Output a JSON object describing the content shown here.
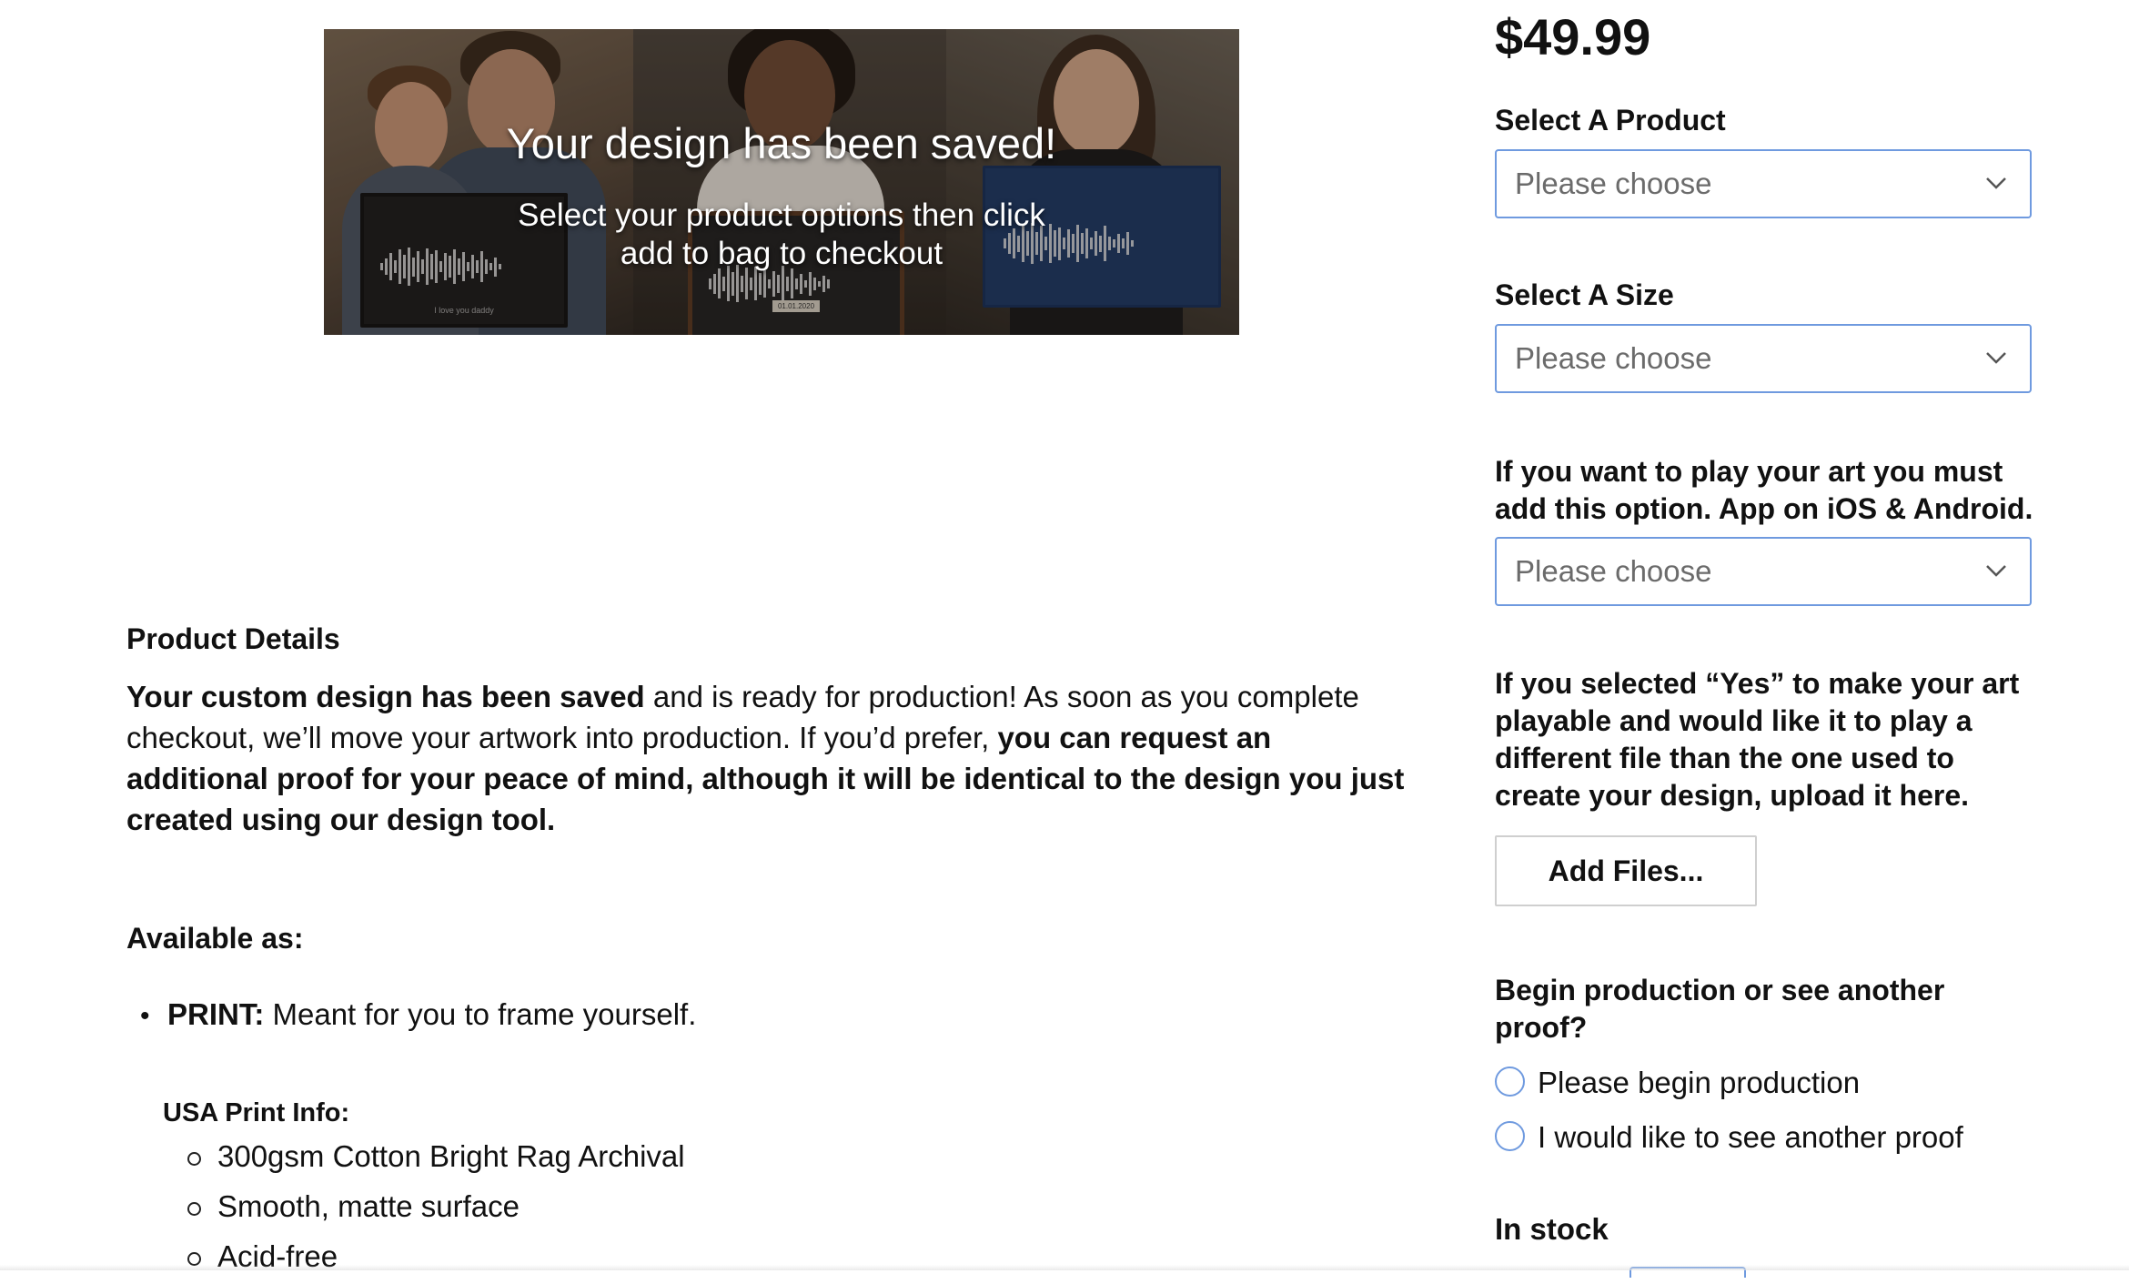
{
  "hero": {
    "title": "Your design has been saved!",
    "subtitle_line1": "Select your product options then click",
    "subtitle_line2": "add to bag to checkout",
    "frame1_caption": "I love you daddy",
    "frame2_tag": "01.01.2020"
  },
  "details": {
    "heading": "Product Details",
    "para_bold_1": "Your custom design has been saved",
    "para_text_1": " and is ready for production! As soon as you complete checkout, we’ll move your artwork into production. If you’d prefer, ",
    "para_bold_2": "you can request an additional proof for your peace of mind, although it will be identical to the design you just created using our design tool."
  },
  "available": {
    "heading": "Available as:",
    "items": [
      {
        "label": "PRINT:",
        "text": " Meant for you to frame yourself."
      }
    ],
    "usa_heading": "USA Print Info:",
    "usa_items": [
      "300gsm Cotton Bright Rag Archival",
      "Smooth, matte surface",
      "Acid-free"
    ]
  },
  "form": {
    "price": "$49.99",
    "product_label": "Select A Product",
    "product_value": "Please choose",
    "size_label": "Select A Size",
    "size_value": "Please choose",
    "play_label_line1": "If you want to play your art you must",
    "play_label_line2": "add this option. App on iOS & Android.",
    "play_value": "Please choose",
    "upload_label_line1": "If you selected “Yes” to make your art",
    "upload_label_line2": "playable and would like it to play a",
    "upload_label_line3": "different file than the one used to",
    "upload_label_line4": "create your design, upload it here.",
    "add_files_label": "Add Files...",
    "proof_label_line1": "Begin production or see another",
    "proof_label_line2": "proof?",
    "radio_options": [
      "Please begin production",
      "I would like to see another proof"
    ],
    "stock_status": "In stock"
  },
  "colors": {
    "accent": "#6f9adf",
    "text": "#111111",
    "placeholder": "#6b6b6b"
  }
}
